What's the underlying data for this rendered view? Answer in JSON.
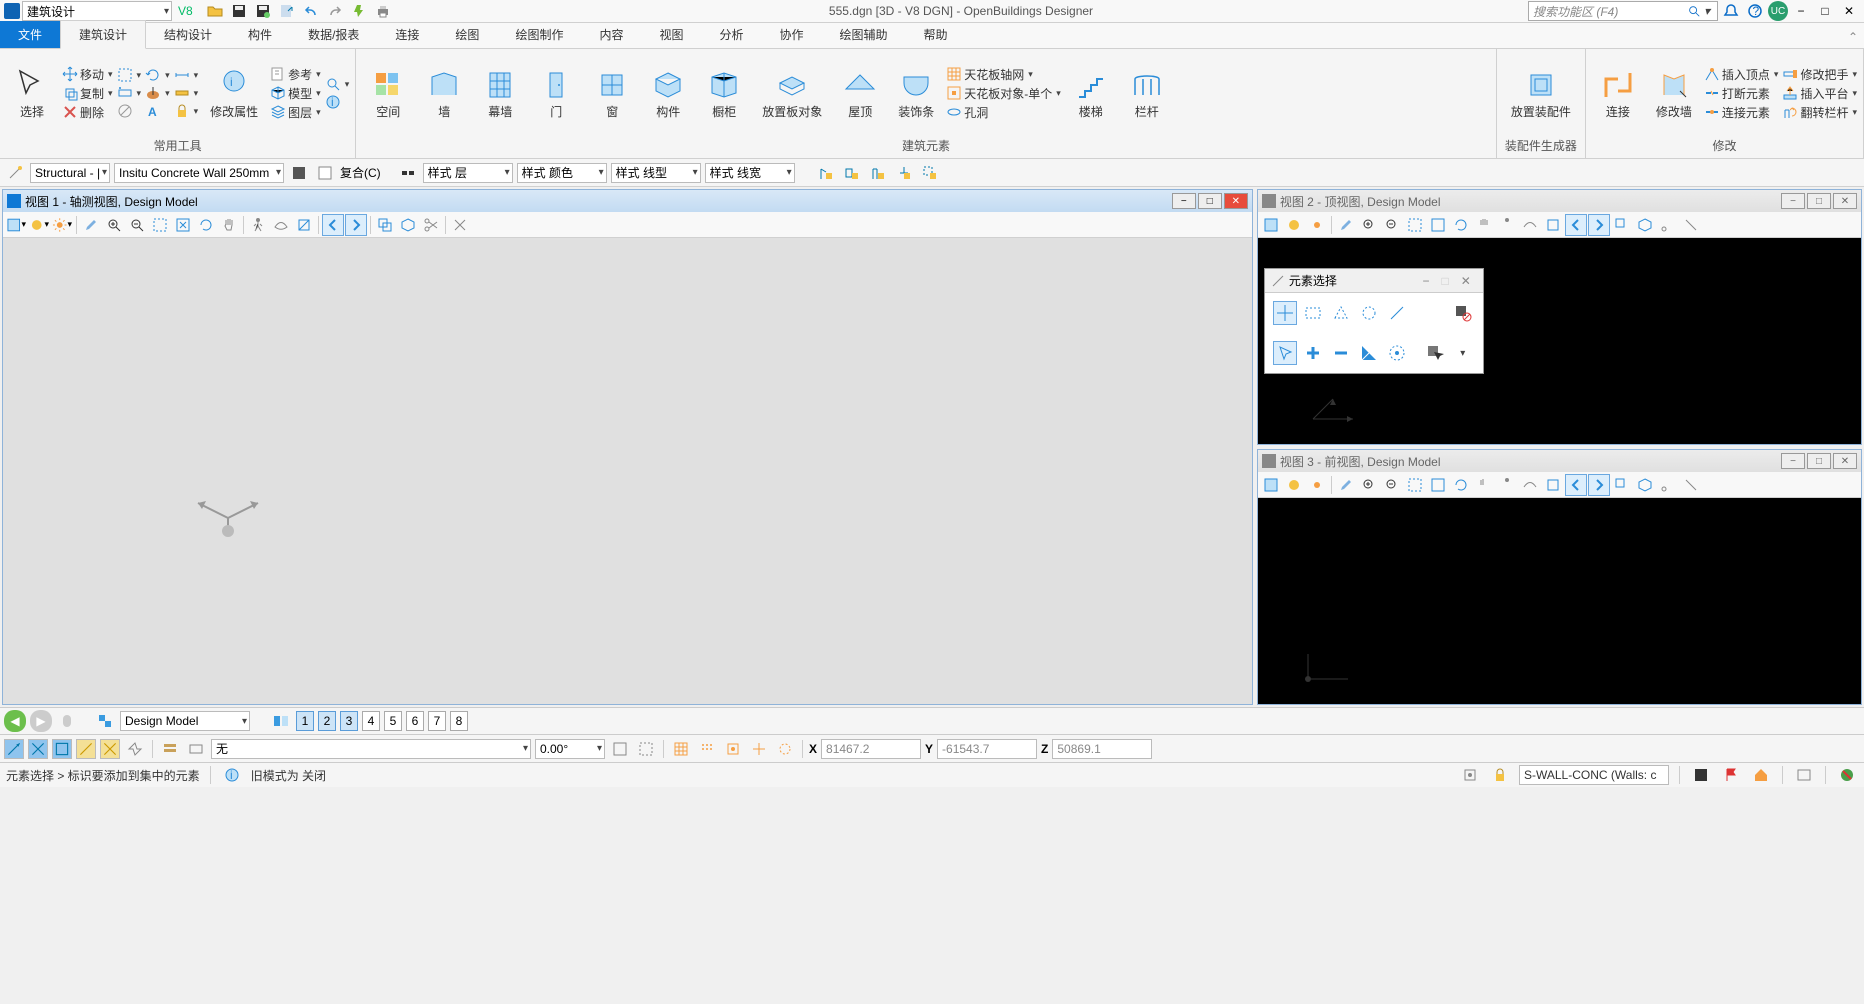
{
  "app": {
    "workset_combo": "建筑设计",
    "title": "555.dgn [3D - V8 DGN] - OpenBuildings Designer",
    "search_placeholder": "搜索功能区 (F4)",
    "user_badge": "UC"
  },
  "ribbon": {
    "file": "文件",
    "tabs": [
      "建筑设计",
      "结构设计",
      "构件",
      "数据/报表",
      "连接",
      "绘图",
      "绘图制作",
      "内容",
      "视图",
      "分析",
      "协作",
      "绘图辅助",
      "帮助"
    ],
    "active_tab": "建筑设计",
    "groups": {
      "selection": {
        "select": "选择",
        "move": "移动",
        "copy": "复制",
        "delete": "删除",
        "label": "常用工具"
      },
      "attrs": {
        "modify_attr": "修改属性",
        "ref": "参考",
        "model": "模型",
        "layer": "图层"
      },
      "building": {
        "space": "空间",
        "wall": "墙",
        "curtain": "幕墙",
        "door": "门",
        "window": "窗",
        "component": "构件",
        "cabinet": "橱柜",
        "board": "放置板对象",
        "roof": "屋顶",
        "trim": "装饰条",
        "ceiling_grid": "天花板轴网",
        "ceiling_unit": "天花板对象-单个",
        "hole": "孔洞",
        "stair": "楼梯",
        "rail": "栏杆",
        "label": "建筑元素"
      },
      "accessory": {
        "place_acc": "放置装配件",
        "label": "装配件生成器"
      },
      "modify": {
        "connect": "连接",
        "modify_wall": "修改墙",
        "insert_vertex": "插入顶点",
        "break": "打断元素",
        "connect_elem": "连接元素",
        "modify_handle": "修改把手",
        "insert_platform": "插入平台",
        "flip_rail": "翻转栏杆",
        "label": "修改"
      }
    }
  },
  "toolstrip": {
    "family": "Structural - |",
    "part": "Insitu Concrete Wall 250mm",
    "composite": "复合(C)",
    "style_layer": "样式 层",
    "style_color": "样式 颜色",
    "style_linetype": "样式 线型",
    "style_lineweight": "样式 线宽"
  },
  "views": {
    "v1": "视图 1 - 轴测视图, Design Model",
    "v2": "视图 2 - 顶视图, Design Model",
    "v3": "视图 3 - 前视图, Design Model"
  },
  "element_select_panel": {
    "title": "元素选择"
  },
  "bottom": {
    "model_combo": "Design Model",
    "view_numbers": [
      "1",
      "2",
      "3",
      "4",
      "5",
      "6",
      "7",
      "8"
    ],
    "active_views": [
      1,
      2,
      3
    ],
    "none": "无",
    "angle": "0.00°",
    "X": "X",
    "Y": "Y",
    "Z": "Z",
    "x_val": "81467.2",
    "y_val": "-61543.7",
    "z_val": "50869.1"
  },
  "status": {
    "left": "元素选择 > 标识要添加到集中的元素",
    "old_mode": "旧模式为 关闭",
    "level": "S-WALL-CONC (Walls: c"
  }
}
